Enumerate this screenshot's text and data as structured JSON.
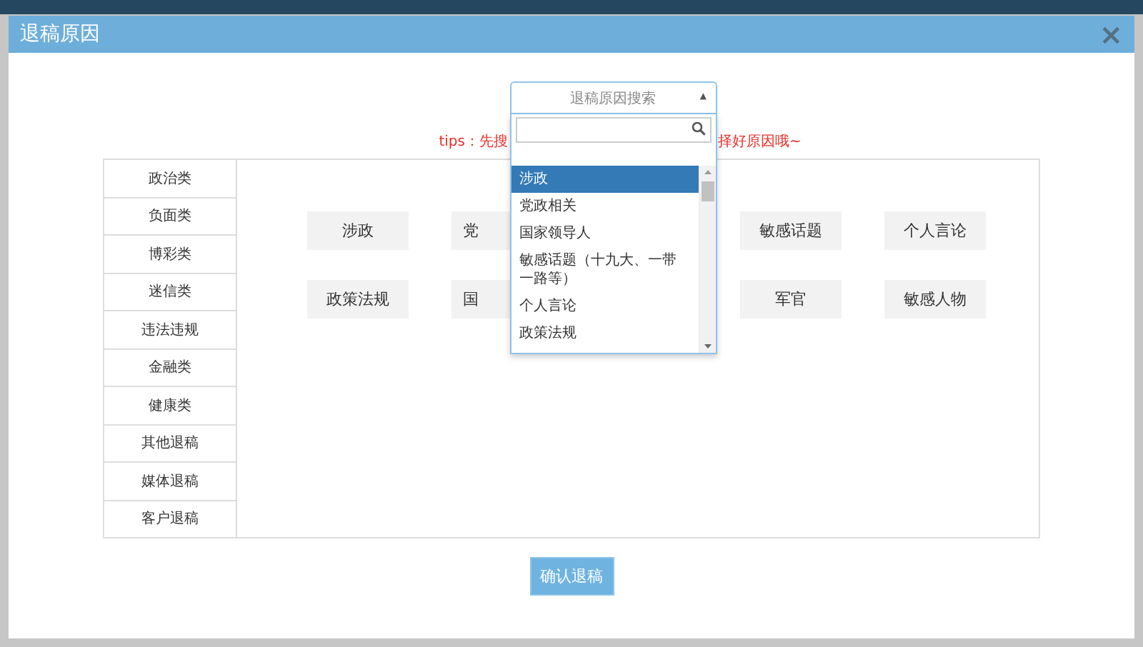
{
  "dialog": {
    "title": "退稿原因",
    "close": "×"
  },
  "reason_select": {
    "placeholder": "退稿原因搜索",
    "caret": "▲",
    "expanded": true,
    "options": [
      {
        "label": "涉政",
        "selected": true
      },
      {
        "label": "党政相关",
        "selected": false
      },
      {
        "label": "国家领导人",
        "selected": false
      },
      {
        "label": "敏感话题（十九大、一带一路等）",
        "selected": false
      },
      {
        "label": "个人言论",
        "selected": false
      },
      {
        "label": "政策法规",
        "selected": false
      }
    ]
  },
  "tips": {
    "left": "tips：先搜",
    "right": "择好原因哦~"
  },
  "categories": [
    {
      "label": "政治类",
      "selected": false
    },
    {
      "label": "负面类",
      "selected": false
    },
    {
      "label": "博彩类",
      "selected": false
    },
    {
      "label": "迷信类",
      "selected": false
    },
    {
      "label": "违法违规",
      "selected": false
    },
    {
      "label": "金融类",
      "selected": false
    },
    {
      "label": "健康类",
      "selected": false
    },
    {
      "label": "其他退稿",
      "selected": false
    },
    {
      "label": "媒体退稿",
      "selected": false
    },
    {
      "label": "客户退稿",
      "selected": false
    }
  ],
  "reason_rows": [
    [
      {
        "label": "涉政",
        "kind": "full"
      },
      {
        "label": "党",
        "kind": "cut"
      },
      {
        "label": "敏感话题",
        "kind": "full"
      },
      {
        "label": "个人言论",
        "kind": "full"
      }
    ],
    [
      {
        "label": "政策法规",
        "kind": "full"
      },
      {
        "label": "国",
        "kind": "cut"
      },
      {
        "label": "军官",
        "kind": "full"
      },
      {
        "label": "敏感人物",
        "kind": "full"
      }
    ]
  ],
  "confirm_button": "确认退稿"
}
